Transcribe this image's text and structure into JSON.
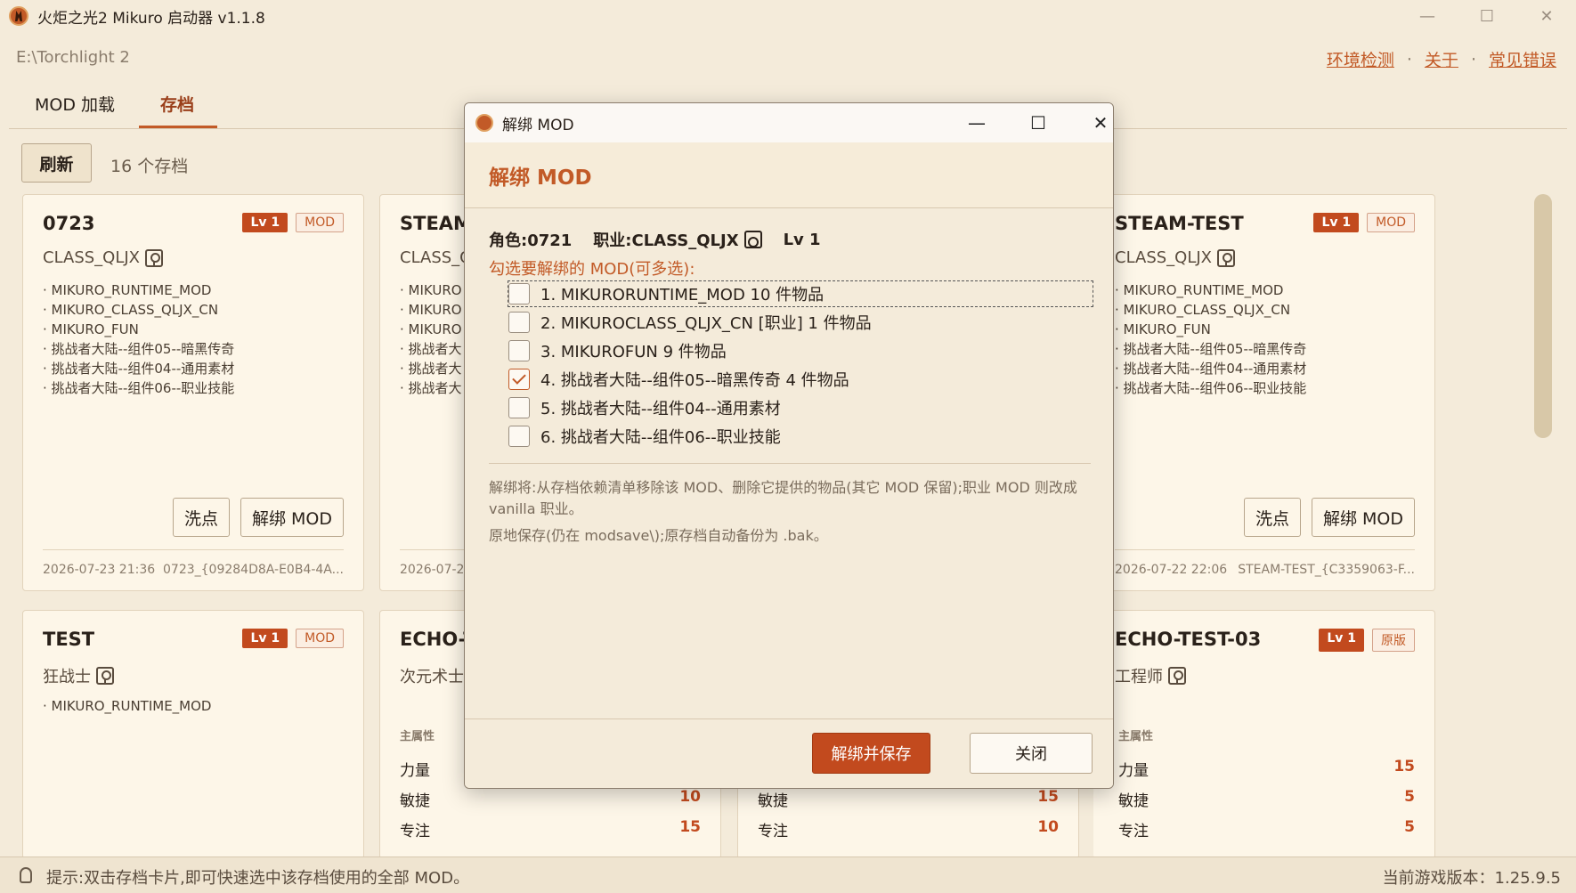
{
  "window": {
    "title": "火炬之光2 Mikuro 启动器   v1.1.8"
  },
  "path": "E:\\Torchlight 2",
  "links": [
    "环境检测",
    "关于",
    "常见错误"
  ],
  "tabs": [
    {
      "label": "MOD 加载"
    },
    {
      "label": "存档"
    }
  ],
  "toolbar": {
    "refresh_label": "刷新",
    "count_label": "16 个存档"
  },
  "cards": {
    "c0723": {
      "title": "0723",
      "lv": "Lv 1",
      "tag": "MOD",
      "class": "CLASS_QLJX",
      "mods": [
        "· MIKURO_RUNTIME_MOD",
        "· MIKURO_CLASS_QLJX_CN",
        "· MIKURO_FUN",
        "· 挑战者大陆--组件05--暗黑传奇",
        "· 挑战者大陆--组件04--通用素材",
        "· 挑战者大陆--组件06--职业技能"
      ],
      "btn_respec": "洗点",
      "btn_unbind": "解绑 MOD",
      "date": "2026-07-23 21:36",
      "file": "0723_{09284D8A-E0B4-4A..."
    },
    "steam": {
      "title": "STEAM",
      "class": "CLASS_Q",
      "mods": [
        "· MIKURO",
        "· MIKURO",
        "· MIKURO",
        "· 挑战者大",
        "· 挑战者大",
        "· 挑战者大"
      ],
      "date": "2026-07-2"
    },
    "steamtest": {
      "title": "STEAM-TEST",
      "lv": "Lv 1",
      "tag": "MOD",
      "class": "CLASS_QLJX",
      "mods": [
        "· MIKURO_RUNTIME_MOD",
        "· MIKURO_CLASS_QLJX_CN",
        "· MIKURO_FUN",
        "· 挑战者大陆--组件05--暗黑传奇",
        "· 挑战者大陆--组件04--通用素材",
        "· 挑战者大陆--组件06--职业技能"
      ],
      "btn_respec": "洗点",
      "btn_unbind": "解绑 MOD",
      "date": "2026-07-22 22:06",
      "file": "STEAM-TEST_{C3359063-F..."
    },
    "test": {
      "title": "TEST",
      "lv": "Lv 1",
      "tag": "MOD",
      "class": "狂战士",
      "mods": [
        "· MIKURO_RUNTIME_MOD"
      ]
    },
    "echo1": {
      "title": "ECHO-T",
      "class": "次元术士",
      "stats_head": "主属性",
      "stats": [
        {
          "k": "力量",
          "v": ""
        },
        {
          "k": "敏捷",
          "v": "10"
        },
        {
          "k": "专注",
          "v": "15"
        }
      ]
    },
    "echo2": {
      "stats": [
        {
          "k": "敏捷",
          "v": "15"
        },
        {
          "k": "专注",
          "v": "10"
        }
      ]
    },
    "echo3": {
      "title": "ECHO-TEST-03",
      "lv": "Lv 1",
      "tag": "原版",
      "class": "工程师",
      "stats_head": "主属性",
      "stats": [
        {
          "k": "力量",
          "v": "15"
        },
        {
          "k": "敏捷",
          "v": "5"
        },
        {
          "k": "专注",
          "v": "5"
        }
      ]
    }
  },
  "dialog": {
    "window_title": "解绑 MOD",
    "heading": "解绑 MOD",
    "char_label": "角色:0721",
    "class_label": "职业:CLASS_QLJX",
    "lv_label": "Lv 1",
    "prompt": "勾选要解绑的 MOD(可多选):",
    "options": [
      {
        "label": "1. MIKURORUNTIME_MOD  10 件物品",
        "checked": false
      },
      {
        "label": "2. MIKUROCLASS_QLJX_CN [职业]  1 件物品",
        "checked": false
      },
      {
        "label": "3. MIKUROFUN  9 件物品",
        "checked": false
      },
      {
        "label": "4. 挑战者大陆--组件05--暗黑传奇  4 件物品",
        "checked": true
      },
      {
        "label": "5. 挑战者大陆--组件04--通用素材",
        "checked": false
      },
      {
        "label": "6. 挑战者大陆--组件06--职业技能",
        "checked": false
      }
    ],
    "note1": "解绑将:从存档依赖清单移除该 MOD、删除它提供的物品(其它 MOD 保留);职业 MOD 则改成 vanilla 职业。",
    "note2": "原地保存(仍在 modsave\\);原存档自动备份为 .bak。",
    "btn_confirm": "解绑并保存",
    "btn_close": "关闭"
  },
  "status": {
    "hint": "提示:双击存档卡片,即可快速选中该存档使用的全部 MOD。",
    "version": "当前游戏版本：1.25.9.5"
  }
}
